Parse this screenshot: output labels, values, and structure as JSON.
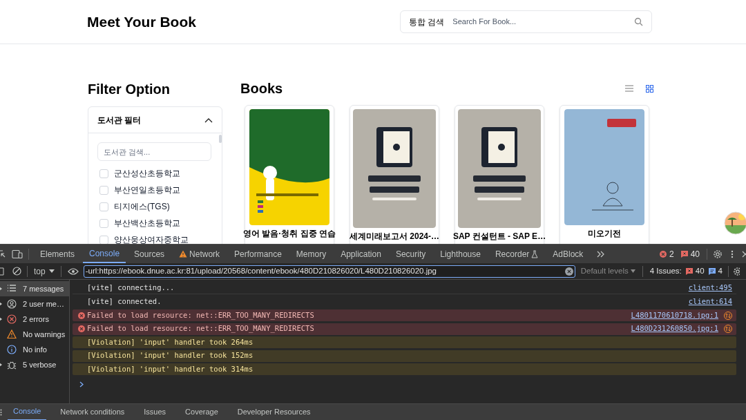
{
  "header": {
    "logo": "Meet Your Book",
    "search": {
      "scope": "통합 검색",
      "placeholder": "Search For Book..."
    }
  },
  "filter": {
    "title": "Filter Option",
    "panel": {
      "title": "도서관 필터",
      "expanded": true,
      "search_placeholder": "도서관 검색...",
      "libraries": [
        {
          "name": "군산성산초등학교",
          "checked": false
        },
        {
          "name": "부산연일초등학교",
          "checked": false
        },
        {
          "name": "티지에스(TGS)",
          "checked": false
        },
        {
          "name": "부산백산초등학교",
          "checked": false
        },
        {
          "name": "양산웅상여자중학교",
          "checked": false
        }
      ]
    }
  },
  "books": {
    "title": "Books",
    "views": [
      {
        "kind": "list",
        "selected": false
      },
      {
        "kind": "grid",
        "selected": true
      }
    ],
    "items": [
      {
        "title": "영어 발음·청취 집중 연습"
      },
      {
        "title": "세계미래보고서 2024-…"
      },
      {
        "title": "SAP 컨설턴트 - SAP E…"
      },
      {
        "title": "미오기전"
      }
    ]
  },
  "devtools": {
    "tabs": [
      {
        "label": "Elements",
        "selected": false
      },
      {
        "label": "Console",
        "selected": true
      },
      {
        "label": "Sources",
        "selected": false
      },
      {
        "label": "Network",
        "selected": false,
        "warning": true
      },
      {
        "label": "Performance",
        "selected": false
      },
      {
        "label": "Memory",
        "selected": false
      },
      {
        "label": "Application",
        "selected": false
      },
      {
        "label": "Security",
        "selected": false
      },
      {
        "label": "Lighthouse",
        "selected": false
      },
      {
        "label": "Recorder",
        "selected": false,
        "flask": true
      },
      {
        "label": "AdBlock",
        "selected": false
      }
    ],
    "error_count": "2",
    "issue_count": "40",
    "context": "top",
    "filter_value": "-url:https://ebook.dnue.ac.kr:81/upload/20568/content/ebook/480D210826020/L480D210826020.jpg",
    "levels": "Default levels",
    "issues_label": "4 Issues:",
    "issues_errors": "40",
    "issues_info": "4",
    "sidebar": [
      {
        "kind": "messages",
        "label": "7 messages",
        "selected": true
      },
      {
        "kind": "user",
        "label": "2 user me…",
        "selected": false
      },
      {
        "kind": "errors",
        "label": "2 errors",
        "selected": false
      },
      {
        "kind": "warnings",
        "label": "No warnings",
        "selected": false
      },
      {
        "kind": "info",
        "label": "No info",
        "selected": false
      },
      {
        "kind": "verbose",
        "label": "5 verbose",
        "selected": false
      }
    ],
    "messages": [
      {
        "kind": "log",
        "text": "[vite] connecting...",
        "source": "client:495"
      },
      {
        "kind": "log",
        "text": "[vite] connected.",
        "source": "client:614"
      },
      {
        "kind": "error",
        "text": "Failed to load resource: net::ERR_TOO_MANY_REDIRECTS",
        "source": "L4801170610718.jpg:1"
      },
      {
        "kind": "error",
        "text": "Failed to load resource: net::ERR_TOO_MANY_REDIRECTS",
        "source": "L480D231260850.jpg:1"
      },
      {
        "kind": "violation",
        "text": "[Violation] 'input' handler took 264ms"
      },
      {
        "kind": "violation",
        "text": "[Violation] 'input' handler took 152ms"
      },
      {
        "kind": "violation",
        "text": "[Violation] 'input' handler took 314ms"
      }
    ],
    "drawer_tabs": [
      {
        "label": "Console",
        "selected": true
      },
      {
        "label": "Network conditions",
        "selected": false
      },
      {
        "label": "Issues",
        "selected": false
      },
      {
        "label": "Coverage",
        "selected": false
      },
      {
        "label": "Developer Resources",
        "selected": false
      }
    ]
  }
}
